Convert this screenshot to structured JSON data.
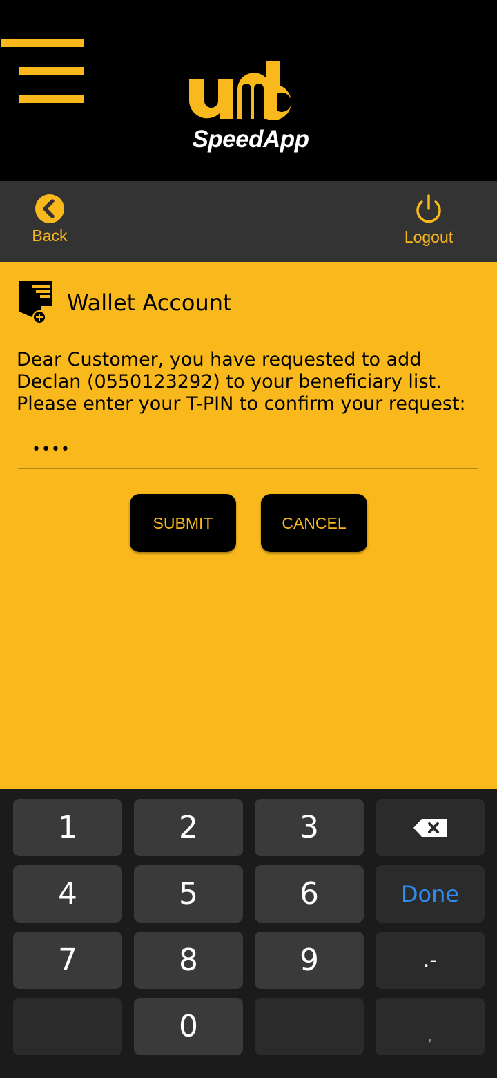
{
  "header": {
    "logo_wordmark": "umb",
    "logo_text": "SpeedApp"
  },
  "toolbar": {
    "back_label": "Back",
    "logout_label": "Logout"
  },
  "section": {
    "title": "Wallet Account"
  },
  "message": "Dear Customer, you have requested to add Declan (0550123292) to your beneficiary list. Please enter your T-PIN to confirm your request:",
  "pin": {
    "value": "••••"
  },
  "buttons": {
    "submit": "SUBMIT",
    "cancel": "CANCEL"
  },
  "keyboard": {
    "keys": [
      "1",
      "2",
      "3",
      "4",
      "5",
      "6",
      "7",
      "8",
      "9",
      "0"
    ],
    "done": "Done",
    "punct": ".-",
    "comma": ","
  },
  "colors": {
    "accent": "#f9b81b",
    "toolbar": "#333333",
    "done_blue": "#2f8bf0"
  }
}
